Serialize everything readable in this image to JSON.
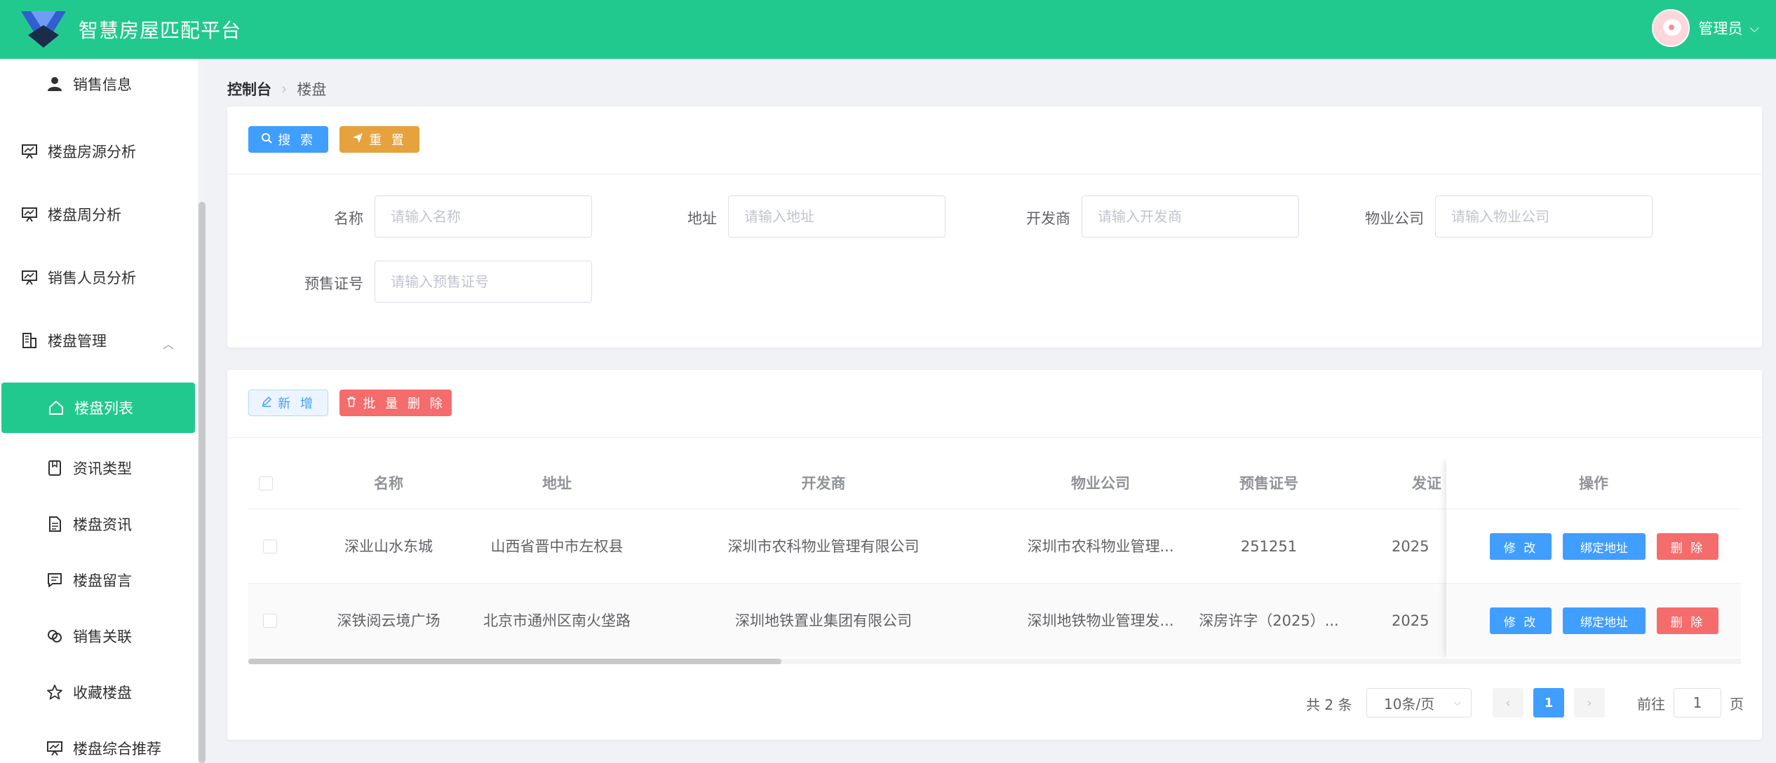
{
  "header": {
    "app_title": "智慧房屋匹配平台",
    "user_name": "管理员",
    "brand_color": "#22c98f"
  },
  "sidebar": {
    "items": [
      {
        "label": "销售信息",
        "icon": "user-icon"
      },
      {
        "label": "楼盘房源分析",
        "icon": "chart-board-icon"
      },
      {
        "label": "楼盘周分析",
        "icon": "chart-board-icon"
      },
      {
        "label": "销售人员分析",
        "icon": "chart-board-icon"
      },
      {
        "label": "楼盘管理",
        "icon": "building-icon"
      },
      {
        "label": "楼盘列表",
        "icon": "home-icon"
      },
      {
        "label": "资讯类型",
        "icon": "notebook-icon"
      },
      {
        "label": "楼盘资讯",
        "icon": "document-icon"
      },
      {
        "label": "楼盘留言",
        "icon": "chat-icon"
      },
      {
        "label": "销售关联",
        "icon": "link-icon"
      },
      {
        "label": "收藏楼盘",
        "icon": "star-icon"
      },
      {
        "label": "楼盘综合推荐",
        "icon": "chart-board-icon"
      }
    ]
  },
  "breadcrumb": {
    "root": "控制台",
    "current": "楼盘"
  },
  "search": {
    "search_label": "搜 索",
    "reset_label": "重 置",
    "fields": [
      {
        "label": "名称",
        "placeholder": "请输入名称"
      },
      {
        "label": "地址",
        "placeholder": "请输入地址"
      },
      {
        "label": "开发商",
        "placeholder": "请输入开发商"
      },
      {
        "label": "物业公司",
        "placeholder": "请输入物业公司"
      },
      {
        "label": "预售证号",
        "placeholder": "请输入预售证号"
      }
    ]
  },
  "toolbar": {
    "add_label": "新 增",
    "batch_delete_label": "批 量 删 除"
  },
  "table": {
    "columns": [
      "名称",
      "地址",
      "开发商",
      "物业公司",
      "预售证号",
      "发证"
    ],
    "action_column": "操作",
    "rows": [
      {
        "name": "深业山水东城",
        "address": "山西省晋中市左权县",
        "developer": "深圳市农科物业管理有限公司",
        "property": "深圳市农科物业管理...",
        "presale": "251251",
        "issue": "2025"
      },
      {
        "name": "深铁阅云境广场",
        "address": "北京市通州区南火垡路",
        "developer": "深圳地铁置业集团有限公司",
        "property": "深圳地铁物业管理发...",
        "presale": "深房许字（2025）...",
        "issue": "2025"
      }
    ],
    "edit_label": "修 改",
    "bind_label": "绑定地址",
    "delete_label": "删 除"
  },
  "pagination": {
    "total": "共 2 条",
    "page_size": "10条/页",
    "current_page": "1",
    "goto_prefix": "前往",
    "goto_value": "1",
    "goto_suffix": "页"
  }
}
